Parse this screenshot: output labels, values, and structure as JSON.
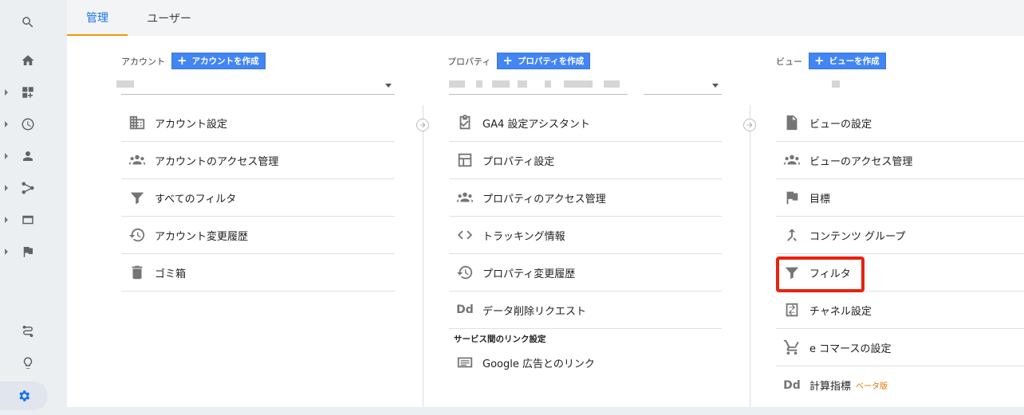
{
  "tabs": [
    {
      "label": "管理"
    },
    {
      "label": "ユーザー"
    }
  ],
  "account": {
    "label": "アカウント",
    "create": "アカウントを作成",
    "items": [
      {
        "label": "アカウント設定",
        "icon": "building-icon"
      },
      {
        "label": "アカウントのアクセス管理",
        "icon": "people-icon"
      },
      {
        "label": "すべてのフィルタ",
        "icon": "filter-icon"
      },
      {
        "label": "アカウント変更履歴",
        "icon": "history-icon"
      },
      {
        "label": "ゴミ箱",
        "icon": "trash-icon"
      }
    ]
  },
  "property": {
    "label": "プロパティ",
    "create": "プロパティを作成",
    "items": [
      {
        "label": "GA4 設定アシスタント",
        "icon": "checkbox-icon"
      },
      {
        "label": "プロパティ設定",
        "icon": "layout-icon"
      },
      {
        "label": "プロパティのアクセス管理",
        "icon": "people-icon"
      },
      {
        "label": "トラッキング情報",
        "icon": "code-icon"
      },
      {
        "label": "プロパティ変更履歴",
        "icon": "history-icon"
      },
      {
        "label": "データ削除リクエスト",
        "icon": "dd-icon"
      }
    ],
    "section": "サービス間のリンク設定",
    "links": [
      {
        "label": "Google 広告とのリンク",
        "icon": "ads-icon"
      }
    ]
  },
  "view": {
    "label": "ビュー",
    "create": "ビューを作成",
    "items": [
      {
        "label": "ビューの設定",
        "icon": "document-icon"
      },
      {
        "label": "ビューのアクセス管理",
        "icon": "people-icon"
      },
      {
        "label": "目標",
        "icon": "flag-icon"
      },
      {
        "label": "コンテンツ グループ",
        "icon": "merge-icon"
      },
      {
        "label": "フィルタ",
        "icon": "filter-icon"
      },
      {
        "label": "チャネル設定",
        "icon": "channel-icon"
      },
      {
        "label": "e コマースの設定",
        "icon": "cart-icon"
      },
      {
        "label": "計算指標",
        "icon": "dd-icon",
        "badge": "ベータ版"
      }
    ]
  },
  "colors": {
    "accent": "#1a73e8",
    "button": "#4285f4",
    "highlight": "#e8210f",
    "tab_underline": "#f29900"
  }
}
